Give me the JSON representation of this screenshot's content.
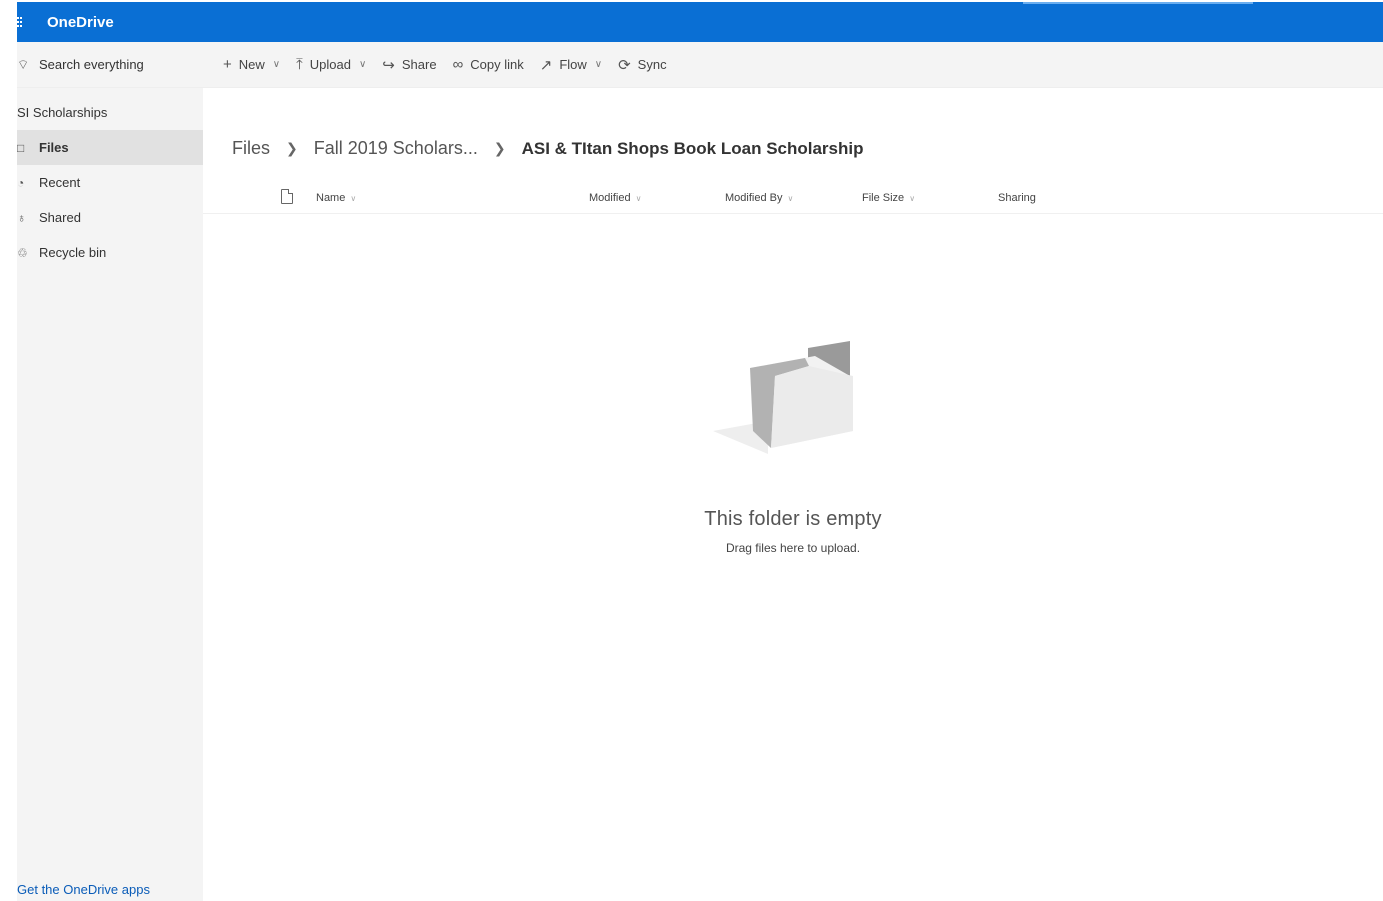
{
  "suitebar": {
    "app_title": "OneDrive",
    "background": "#0a6fd4"
  },
  "search": {
    "placeholder": "Search everything"
  },
  "commands": [
    {
      "label": "New",
      "icon": "plus-icon",
      "has_dropdown": true
    },
    {
      "label": "Upload",
      "icon": "upload-icon",
      "has_dropdown": true
    },
    {
      "label": "Share",
      "icon": "share-icon",
      "has_dropdown": false
    },
    {
      "label": "Copy link",
      "icon": "link-icon",
      "has_dropdown": false
    },
    {
      "label": "Flow",
      "icon": "flow-icon",
      "has_dropdown": true
    },
    {
      "label": "Sync",
      "icon": "sync-icon",
      "has_dropdown": false
    }
  ],
  "nav": {
    "site_name": "SI Scholarships",
    "items": [
      {
        "label": "Files",
        "icon": "folder-icon",
        "active": true
      },
      {
        "label": "Recent",
        "icon": "clock-icon",
        "active": false
      },
      {
        "label": "Shared",
        "icon": "people-icon",
        "active": false
      },
      {
        "label": "Recycle bin",
        "icon": "trash-icon",
        "active": false
      }
    ],
    "footer_link": "Get the OneDrive apps"
  },
  "breadcrumb": {
    "items": [
      "Files",
      "Fall 2019 Scholars..."
    ],
    "current": "ASI & TItan Shops Book Loan Scholarship"
  },
  "columns": {
    "name": "Name",
    "modified": "Modified",
    "modified_by": "Modified By",
    "file_size": "File Size",
    "sharing": "Sharing"
  },
  "empty_state": {
    "title": "This folder is empty",
    "subtitle": "Drag files here to upload."
  }
}
